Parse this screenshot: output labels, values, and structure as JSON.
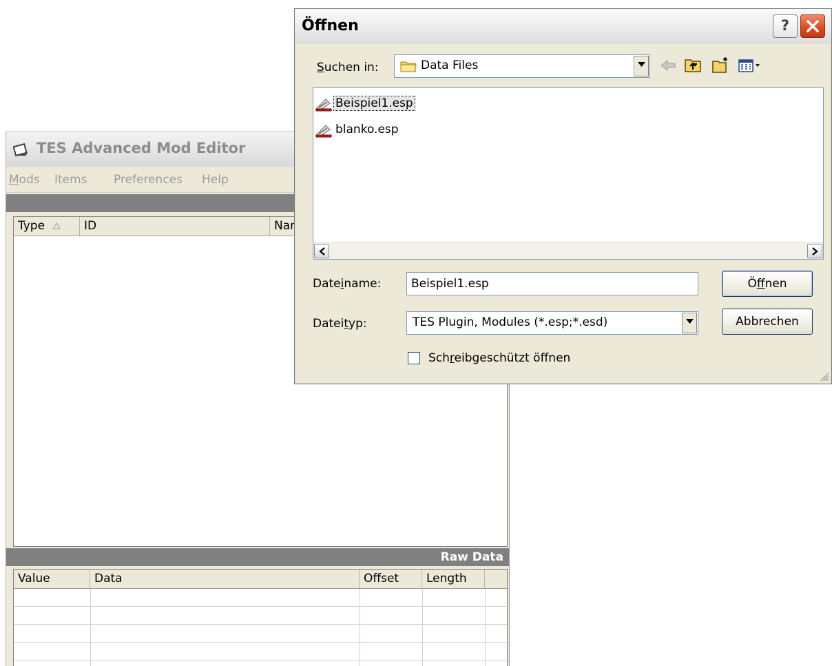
{
  "main_window": {
    "title": "TES Advanced Mod Editor",
    "menu": [
      "Mods",
      "Items",
      "Preferences",
      "Help"
    ],
    "list_columns": [
      "Type",
      "ID",
      "Nam"
    ],
    "raw_header": "Raw Data",
    "raw_columns": [
      "Value",
      "Data",
      "Offset",
      "Length"
    ]
  },
  "dialog": {
    "title": "Öffnen",
    "help_label": "?",
    "look_in_label": "Suchen in:",
    "look_in_value": "Data Files",
    "files": [
      {
        "name": "Beispiel1.esp",
        "selected": true,
        "icon": "plugin-file-icon"
      },
      {
        "name": "blanko.esp",
        "selected": false,
        "icon": "plugin-file-icon"
      }
    ],
    "filename_label": "Dateiname:",
    "filename_value": "Beispiel1.esp",
    "filetype_label": "Dateityp:",
    "filetype_value": "TES Plugin, Modules (*.esp;*.esd)",
    "readonly_label": "Schreibgeschützt öffnen",
    "open_button": "Öffnen",
    "cancel_button": "Abbrechen"
  },
  "colors": {
    "dialog_bg": "#ece9d8",
    "close_button": "#d84a22",
    "header_bar": "#808080",
    "field_border": "#7f9db9"
  }
}
